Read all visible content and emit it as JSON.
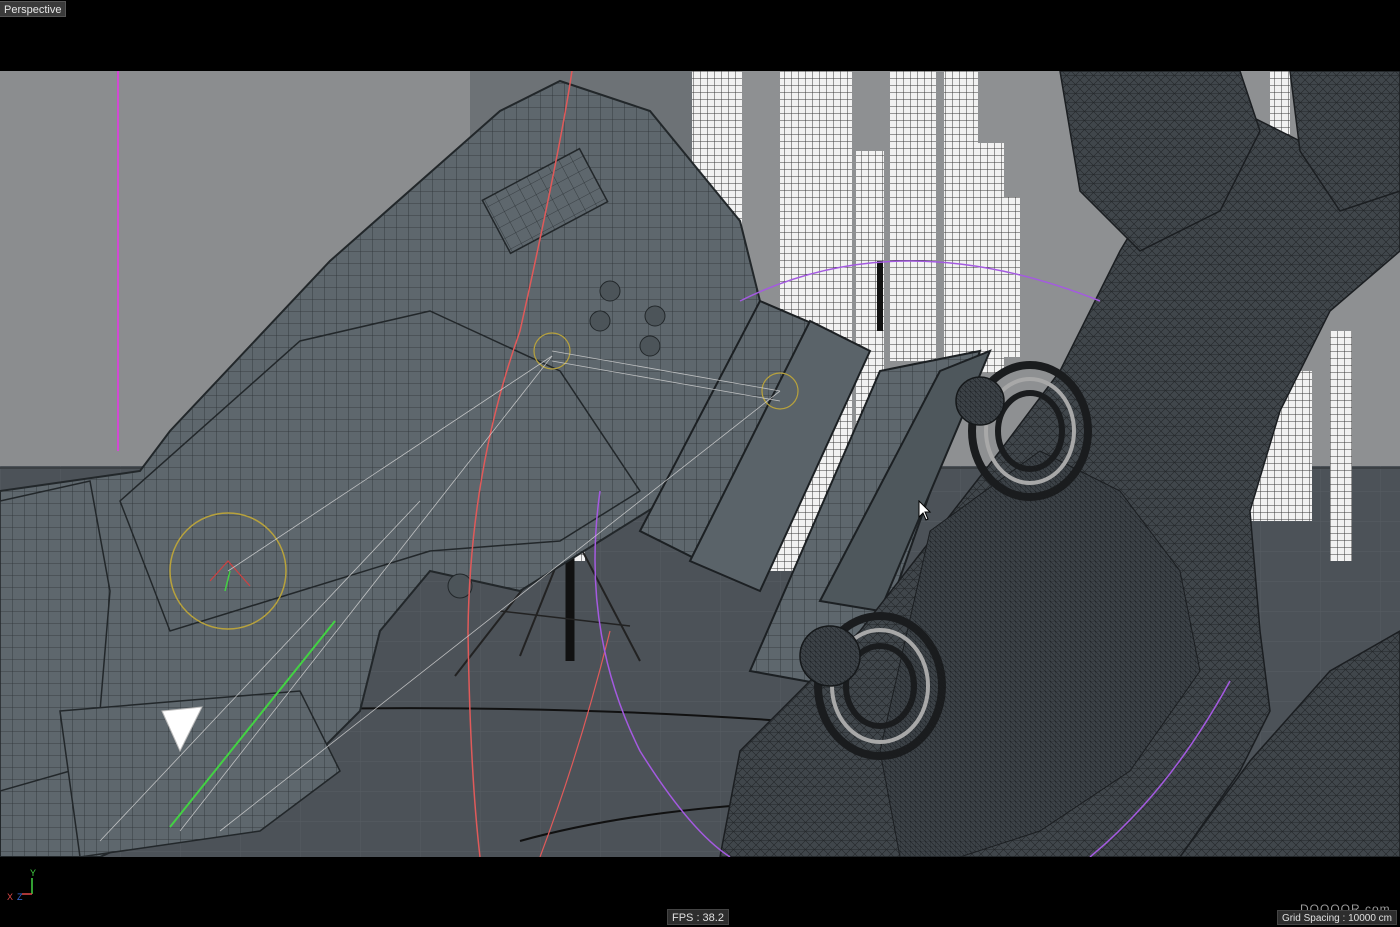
{
  "viewport": {
    "label": "Perspective",
    "fps_text": "FPS : 38.2",
    "grid_spacing_text": "Grid Spacing : 10000 cm",
    "watermark": "DOOOOR.com"
  },
  "axis_gizmo": {
    "x": "X",
    "y": "Y",
    "z": "Z"
  },
  "colors": {
    "background": "#000000",
    "scene_floor": "#4b5157",
    "wall": "#8d8f91",
    "mesh": "#5d666c",
    "wire": "#2b2f33",
    "x_axis": "#e04848",
    "y_axis": "#43d243",
    "z_axis": "#3a6bd8",
    "spline_red": "#e05a5a",
    "spline_purple": "#a45ae0",
    "selection_yellow": "#b8a23c"
  },
  "icons": [
    "mouse-cursor-icon",
    "axis-gizmo-icon"
  ]
}
